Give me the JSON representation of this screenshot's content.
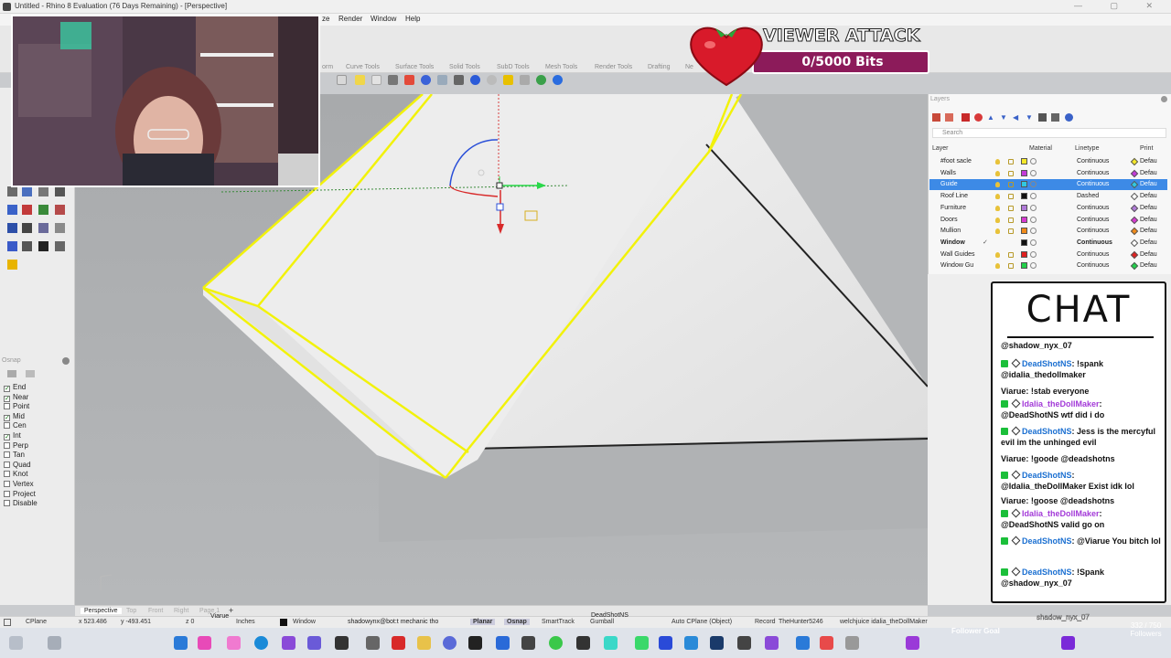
{
  "window": {
    "title": "Untitled - Rhino 8 Evaluation (76 Days Remaining) - [Perspective]"
  },
  "menu": {
    "items": [
      {
        "label": "ze"
      },
      {
        "label": "Render"
      },
      {
        "label": "Window"
      },
      {
        "label": "Help"
      }
    ]
  },
  "toolbar_tabs": [
    {
      "label": "orm"
    },
    {
      "label": "Curve Tools"
    },
    {
      "label": "Surface Tools"
    },
    {
      "label": "Solid Tools"
    },
    {
      "label": "SubD Tools"
    },
    {
      "label": "Mesh Tools"
    },
    {
      "label": "Render Tools"
    },
    {
      "label": "Drafting"
    },
    {
      "label": "Ne"
    }
  ],
  "osnap": {
    "title": "Osnap",
    "items": [
      {
        "label": "End",
        "checked": true
      },
      {
        "label": "Near",
        "checked": true
      },
      {
        "label": "Point",
        "checked": false
      },
      {
        "label": "Mid",
        "checked": true
      },
      {
        "label": "Cen",
        "checked": false
      },
      {
        "label": "Int",
        "checked": true
      },
      {
        "label": "Perp",
        "checked": false
      },
      {
        "label": "Tan",
        "checked": false
      },
      {
        "label": "Quad",
        "checked": false
      },
      {
        "label": "Knot",
        "checked": false
      },
      {
        "label": "Vertex",
        "checked": false
      },
      {
        "label": "Project",
        "checked": false
      },
      {
        "label": "Disable",
        "checked": false
      }
    ]
  },
  "layers": {
    "title": "Layers",
    "search_placeholder": "Search",
    "headers": {
      "layer": "Layer",
      "material": "Material",
      "linetype": "Linetype",
      "print": "Print"
    },
    "rows": [
      {
        "name": "#foot sacle",
        "color": "#f5e82a",
        "linetype": "Continuous",
        "print": "Defau",
        "print_color": "#f5e82a",
        "selected": false
      },
      {
        "name": "Walls",
        "color": "#c23ad8",
        "linetype": "Continuous",
        "print": "Defau",
        "print_color": "#c23ad8",
        "selected": false
      },
      {
        "name": "Guide",
        "color": "#30c8e0",
        "linetype": "Continuous",
        "print": "Defau",
        "print_color": "#30c8e0",
        "selected": true
      },
      {
        "name": "Roof Line",
        "color": "#111111",
        "linetype": "Dashed",
        "print": "Defau",
        "print_color": "#ffffff",
        "selected": false
      },
      {
        "name": "Furniture",
        "color": "#b07ad8",
        "linetype": "Continuous",
        "print": "Defau",
        "print_color": "#b07ad8",
        "selected": false
      },
      {
        "name": "Doors",
        "color": "#d63ad0",
        "linetype": "Continuous",
        "print": "Defau",
        "print_color": "#d63ad0",
        "selected": false
      },
      {
        "name": "Mullion",
        "color": "#f08a1a",
        "linetype": "Continuous",
        "print": "Defau",
        "print_color": "#f08a1a",
        "selected": false
      },
      {
        "name": "Window",
        "color": "#111111",
        "linetype": "Continuous",
        "print": "Defau",
        "print_color": "#ffffff",
        "selected": false
      },
      {
        "name": "Wall Guides",
        "color": "#e02020",
        "linetype": "Continuous",
        "print": "Defau",
        "print_color": "#e02020",
        "selected": false
      },
      {
        "name": "Window Gu",
        "color": "#22d04a",
        "linetype": "Continuous",
        "print": "Defau",
        "print_color": "#22d04a",
        "selected": false
      }
    ]
  },
  "viewport": {
    "tabs": [
      {
        "label": "Perspective",
        "active": true
      },
      {
        "label": "Top",
        "active": false
      },
      {
        "label": "Front",
        "active": false
      },
      {
        "label": "Right",
        "active": false
      },
      {
        "label": "Page 1",
        "active": false
      }
    ]
  },
  "statusbar": {
    "cplane": "CPlane",
    "x": "x 523.486",
    "y": "y -493.451",
    "z": "z 0",
    "units": "Inches",
    "layer": "Window",
    "planar": "Planar",
    "osnap": "Osnap",
    "smarttrack": "SmartTrack",
    "gumball": "Gumball",
    "autocplane": "Auto CPlane (Object)",
    "record": "Record"
  },
  "overlay": {
    "viewer_attack_title": "VIEWER ATTACK",
    "viewer_attack_value": "0/5000 Bits",
    "chat_title": "CHAT",
    "follower_goal_label": "Follower Goal",
    "followers_value": "332 / 750",
    "followers_label": "Followers",
    "scroll_names": "shadowynx@bot:t mechanic tho",
    "scroll_names2": "TheHunter5246",
    "scroll_names3": "welchjuice idalia_theDollMaker",
    "scroll_names4": "DeadShotNS",
    "scroll_names5": "shadow_nyx_07",
    "viarue_tag": "Viarue"
  },
  "chat": {
    "messages": [
      {
        "user": "@shadow_nyx_07",
        "text": "",
        "user_color": "#111111",
        "badges": false
      },
      {
        "user": "DeadShotNS",
        "text": ": !spank @idalia_thedollmaker",
        "user_color": "#1a6fd1",
        "badges": true
      },
      {
        "user": "Viarue",
        "text": ": !stab everyone",
        "user_color": "#111111",
        "badges": false
      },
      {
        "user": "Idalia_theDollMaker",
        "text": ": @DeadShotNS wtf did i do",
        "user_color": "#a33ad8",
        "badges": true
      },
      {
        "user": "DeadShotNS",
        "text": ": Jess is the mercyful evil im the unhinged evil",
        "user_color": "#1a6fd1",
        "badges": true
      },
      {
        "user": "Viarue",
        "text": ": !goode @deadshotns",
        "user_color": "#111111",
        "badges": false
      },
      {
        "user": "DeadShotNS",
        "text": ": @Idalia_theDollMaker Exist idk lol",
        "user_color": "#1a6fd1",
        "badges": true
      },
      {
        "user": "Viarue",
        "text": ": !goose @deadshotns",
        "user_color": "#111111",
        "badges": false
      },
      {
        "user": "Idalia_theDollMaker",
        "text": ": @DeadShotNS valid go on",
        "user_color": "#a33ad8",
        "badges": true
      },
      {
        "user": "DeadShotNS",
        "text": ": @Viarue You bitch lol",
        "user_color": "#1a6fd1",
        "badges": true
      },
      {
        "user": "DeadShotNS",
        "text": ": !Spank @shadow_nyx_07",
        "user_color": "#1a6fd1",
        "badges": true
      }
    ]
  },
  "colors": {
    "selection_yellow": "#f2f20a",
    "layer_selected": "#3d8ae6",
    "bits_bar": "#8c1b5a"
  }
}
